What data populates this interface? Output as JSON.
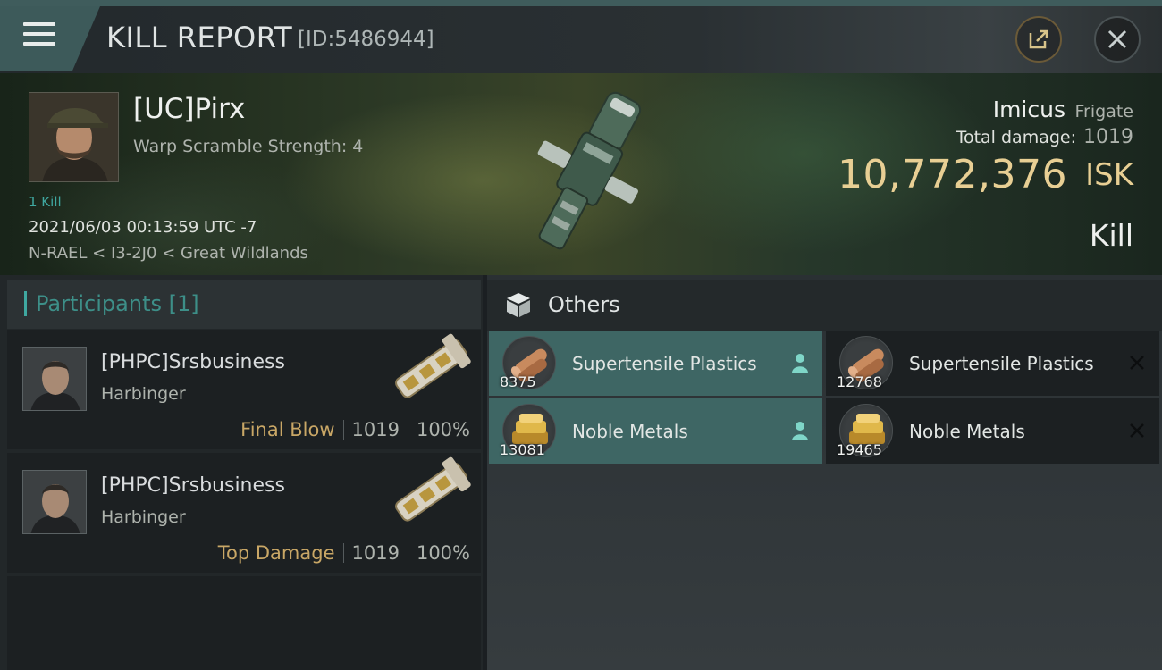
{
  "header": {
    "title": "KILL REPORT",
    "report_id": "[ID:5486944]"
  },
  "victim": {
    "pilot": "[UC]Pirx",
    "warp_scramble": "Warp Scramble Strength: 4",
    "kill_count": "1 Kill",
    "datetime": "2021/06/03 00:13:59 UTC -7",
    "location": "N-RAEL < I3-2J0 < Great Wildlands",
    "ship_name": "Imicus",
    "ship_class": "Frigate",
    "total_damage_label": "Total damage:",
    "total_damage": "1019",
    "isk_value": "10,772,376",
    "isk_unit": "ISK",
    "result": "Kill"
  },
  "participants": {
    "header": "Participants [1]",
    "rows": [
      {
        "name": "[PHPC]Srsbusiness",
        "ship": "Harbinger",
        "tag": "Final Blow",
        "damage": "1019",
        "percent": "100%"
      },
      {
        "name": "[PHPC]Srsbusiness",
        "ship": "Harbinger",
        "tag": "Top Damage",
        "damage": "1019",
        "percent": "100%"
      }
    ]
  },
  "others": {
    "header": "Others",
    "items": [
      {
        "name": "Supertensile Plastics",
        "qty": "8375",
        "status": "dropped",
        "icon": "plastics-icon"
      },
      {
        "name": "Supertensile Plastics",
        "qty": "12768",
        "status": "destroyed",
        "icon": "plastics-icon"
      },
      {
        "name": "Noble Metals",
        "qty": "13081",
        "status": "dropped",
        "icon": "metals-icon"
      },
      {
        "name": "Noble Metals",
        "qty": "19465",
        "status": "destroyed",
        "icon": "metals-icon"
      }
    ]
  },
  "colors": {
    "accent_teal": "#3fa8a0",
    "isk_gold": "#e8cf94",
    "tag_gold": "#c9a766",
    "dropped_bg": "#3e6664"
  }
}
